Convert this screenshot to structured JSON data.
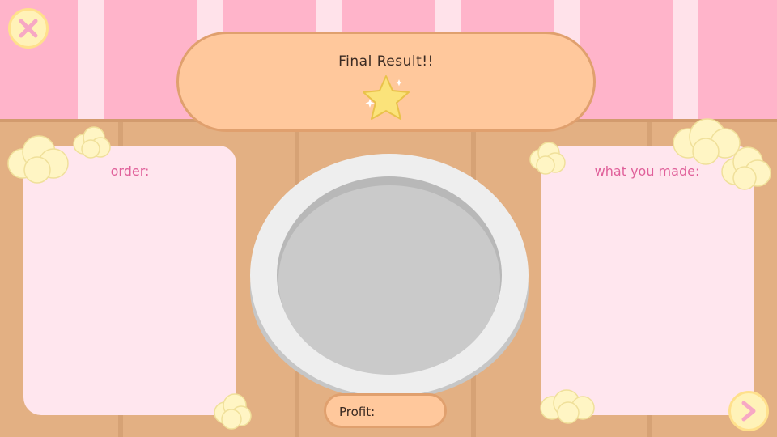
{
  "title": "Final Result!!",
  "order_panel": {
    "heading": "order:"
  },
  "made_panel": {
    "heading": "what you made:"
  },
  "profit": {
    "label": "Profit:"
  },
  "rating": {
    "stars": 1
  },
  "colors": {
    "wallpaper_pink": "#ffb4ca",
    "wallpaper_stripe": "#ffe2ea",
    "table_wood": "#e3b083",
    "banner_peach": "#ffc89c",
    "card_pink": "#ffe6ee",
    "heading_pink": "#e0609a",
    "button_yellow": "#fff2b8",
    "icon_pink": "#f7a8c4",
    "star_yellow": "#fbe37a",
    "plate_rim": "#eeeeee",
    "plate_center": "#c9c9c9"
  },
  "icons": {
    "close": "close-icon",
    "next": "chevron-right-icon",
    "rating": "star-icon",
    "decor": "cream-puff-icon"
  }
}
